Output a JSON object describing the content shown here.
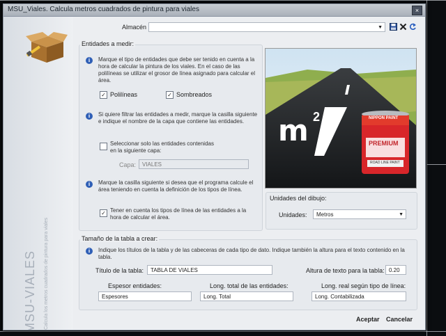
{
  "window": {
    "title": "MSU_Viales. Calcula metros cuadrados de pintura para viales",
    "close_glyph": "×"
  },
  "sidebar": {
    "product": "MSU-VIALES",
    "subtitle": "Calcula los metros cuadrados de pintura para viales"
  },
  "almacen": {
    "label": "Almacén",
    "value": ""
  },
  "entidades": {
    "title": "Entidades a medir:",
    "info1": "Marque el tipo de entidades que debe ser tenido en cuenta a la hora de calcular la pintura de los viales. En el caso de las polilíneas se utilizar el grosor de línea asignado para calcular el área.",
    "polilineas": "Polilíneas",
    "sombreados": "Sombreados",
    "info2": "Si quiere filtrar las entidades a medir, marque la casilla siguiente e indique el nombre de la capa que contiene las entidades.",
    "seleccionar": "Seleccionar solo las entidades contenidas en la siguiente capa:",
    "capa_label": "Capa:",
    "capa_value": "VIALES",
    "info3": "Marque la casilla siguiente si desea que el programa calcule el área teniendo en cuenta la definición de los tipos de línea.",
    "tener": "Tener en cuenta los tipos de línea de las entidades a la hora de calcular el área."
  },
  "image": {
    "m2_text": "m",
    "sup": "2",
    "can_brand": "NIPPON PAINT",
    "can_name": "PREMIUM",
    "can_sub": "ROAD LINE PAINT"
  },
  "unidades": {
    "title": "Unidades del dibujo:",
    "label": "Unidades:",
    "value": "Metros"
  },
  "tabla": {
    "title": "Tamaño de la tabla a crear:",
    "info": "Indique los títulos de la tabla y de las cabeceras de cada tipo de dato. Indique también la altura para el texto contenido en la tabla.",
    "titulo_label": "Título de la tabla:",
    "titulo_value": "TABLA DE VIALES",
    "altura_label": "Altura de texto para la tabla:",
    "altura_value": "0.20",
    "col1_label": "Espesor entidades:",
    "col1_value": "Espesores",
    "col2_label": "Long. total de las entidades:",
    "col2_value": "Long. Total",
    "col3_label": "Long. real según tipo de línea:",
    "col3_value": "Long. Contabilizada"
  },
  "buttons": {
    "aceptar": "Aceptar",
    "cancelar": "Cancelar"
  },
  "colors": {
    "accent": "#2f5fb6",
    "paint_can": "#d8262a"
  }
}
